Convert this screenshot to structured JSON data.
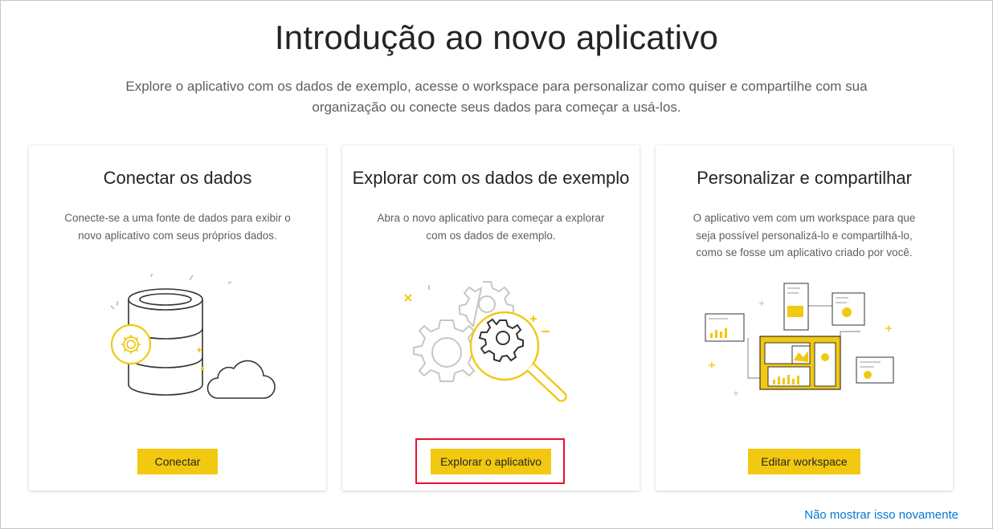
{
  "header": {
    "title": "Introdução ao novo aplicativo",
    "subtitle": "Explore o aplicativo com os dados de exemplo, acesse o workspace para personalizar como quiser e compartilhe com sua organização ou conecte seus dados para começar a usá-los."
  },
  "cards": [
    {
      "title": "Conectar os dados",
      "description": "Conecte-se a uma fonte de dados para exibir o novo aplicativo com seus próprios dados.",
      "button_label": "Conectar",
      "icon": "database-cloud-icon"
    },
    {
      "title": "Explorar com os dados de exemplo",
      "description": "Abra o novo aplicativo para começar a explorar com os dados de exemplo.",
      "button_label": "Explorar o aplicativo",
      "icon": "gears-magnifier-icon"
    },
    {
      "title": "Personalizar e compartilhar",
      "description": "O aplicativo vem com um workspace para que seja possível personalizá-lo e compartilhá-lo, como se fosse um aplicativo criado por você.",
      "button_label": "Editar workspace",
      "icon": "dashboard-share-icon"
    }
  ],
  "footer": {
    "dont_show_label": "Não mostrar isso novamente"
  },
  "colors": {
    "accent": "#f2c811",
    "link": "#0078d4",
    "highlight": "#e8112d"
  }
}
